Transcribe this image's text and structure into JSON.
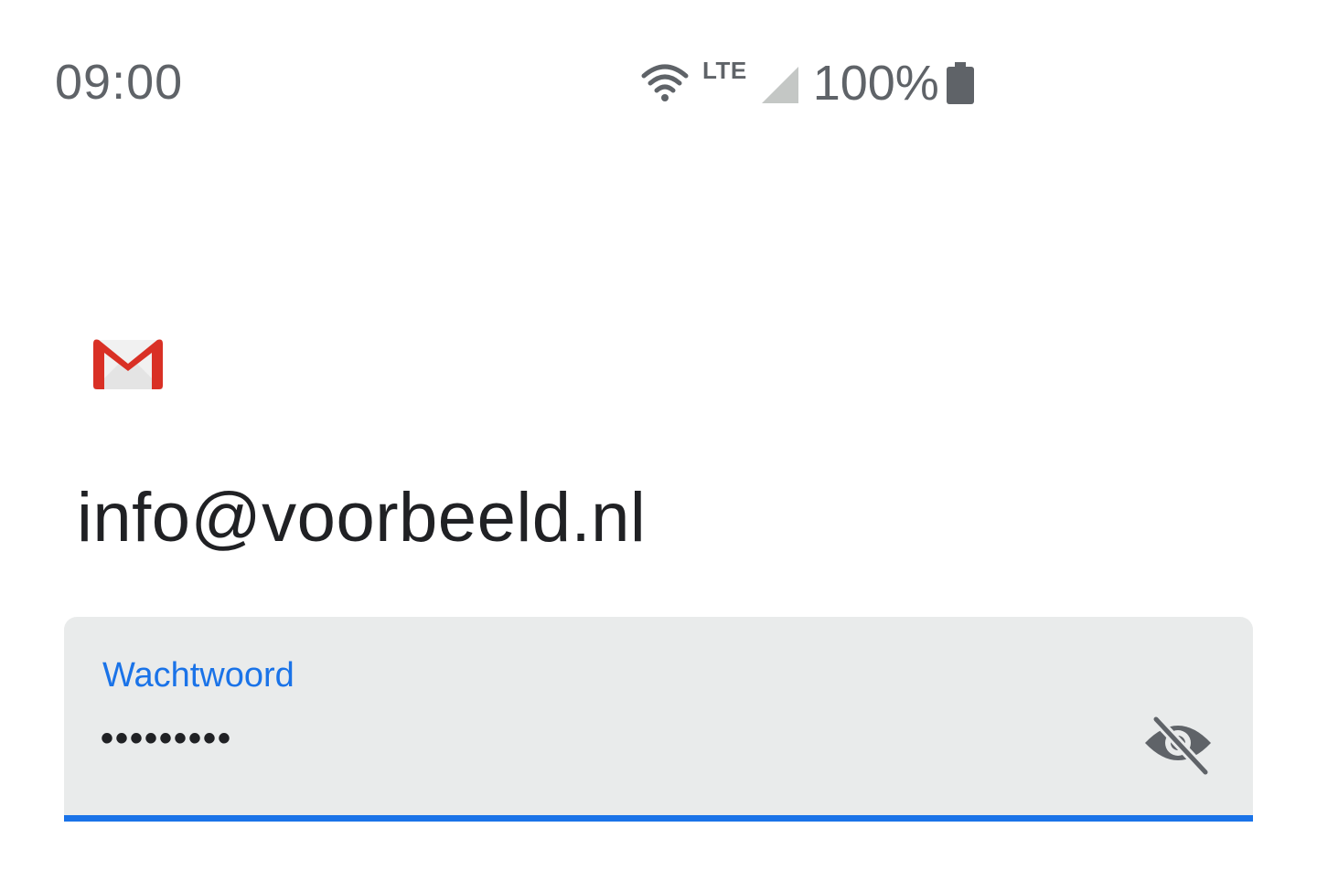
{
  "status_bar": {
    "time": "09:00",
    "network_type": "LTE",
    "battery_percent": "100%",
    "icons": [
      "wifi-icon",
      "signal-icon",
      "battery-icon"
    ]
  },
  "logo": {
    "icon": "gmail-logo-icon",
    "colors": {
      "red": "#d93025",
      "envelope": "#f1f1f1"
    }
  },
  "account": {
    "email": "info@voorbeeld.nl"
  },
  "password_field": {
    "label": "Wachtwoord",
    "value_masked": "•••••••••",
    "toggle_icon": "visibility-off-icon",
    "accent_color": "#1a73e8"
  }
}
